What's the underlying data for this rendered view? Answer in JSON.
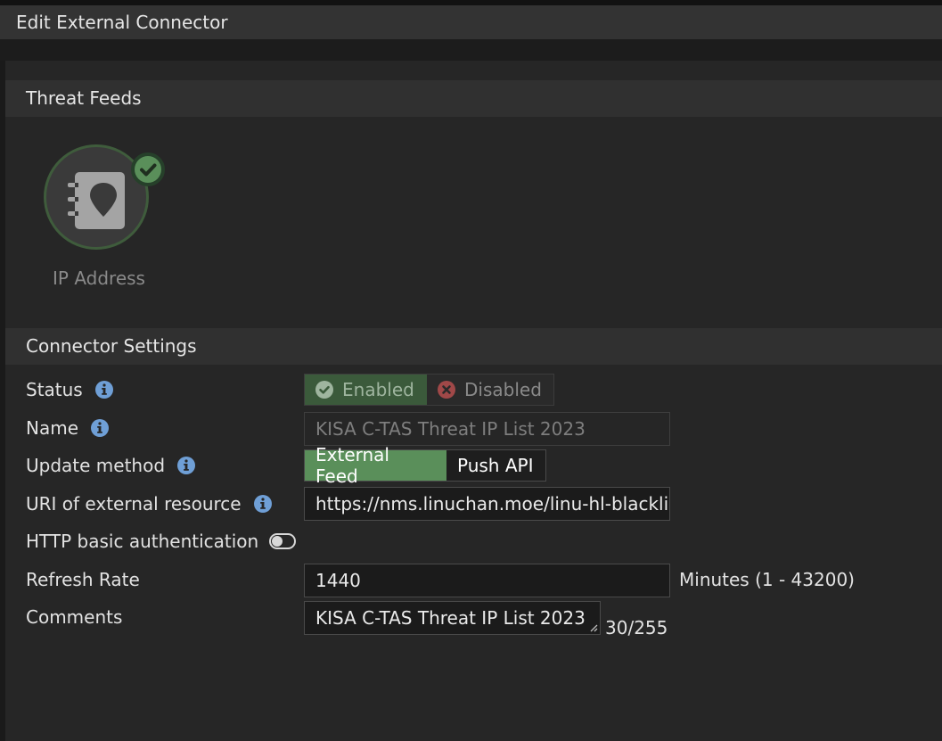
{
  "window": {
    "title": "Edit External Connector"
  },
  "threat_feeds": {
    "header": "Threat Feeds",
    "tiles": [
      {
        "label": "IP Address",
        "selected": true,
        "icon": "address-book-pin-icon"
      }
    ]
  },
  "connector_settings": {
    "header": "Connector Settings",
    "status": {
      "label": "Status",
      "enabled_label": "Enabled",
      "disabled_label": "Disabled",
      "selected": "Enabled"
    },
    "name": {
      "label": "Name",
      "value": "KISA C-TAS Threat IP List 2023"
    },
    "update_method": {
      "label": "Update method",
      "options": [
        "External Feed",
        "Push API"
      ],
      "selected": "External Feed"
    },
    "uri": {
      "label": "URI of external resource",
      "value": "https://nms.linuchan.moe/linu-hl-blackli"
    },
    "http_auth": {
      "label": "HTTP basic authentication",
      "enabled": false
    },
    "refresh_rate": {
      "label": "Refresh Rate",
      "value": "1440",
      "unit_hint": "Minutes (1 - 43200)"
    },
    "comments": {
      "label": "Comments",
      "value": "KISA C-TAS Threat IP List 2023",
      "counter": "30/255"
    }
  },
  "colors": {
    "accent_green": "#5a8f5a",
    "enabled_bg": "#3b5a3b",
    "info_blue": "#6f9fd6",
    "disabled_red": "#a04848"
  }
}
